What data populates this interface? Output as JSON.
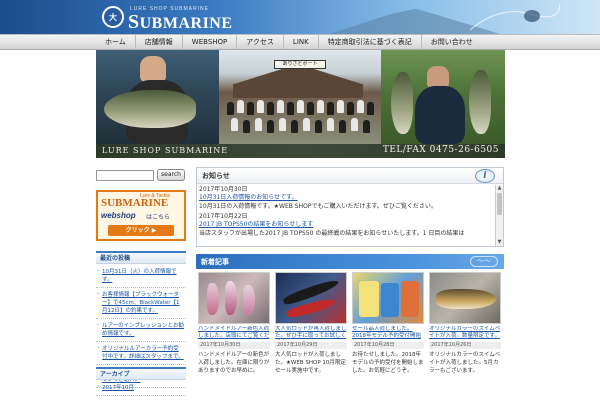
{
  "header": {
    "logo_emblem": "大",
    "logo_subtext": "LURE SHOP SUBMARINE",
    "logo_first_letter": "S",
    "logo_rest": "UBMARINE"
  },
  "nav": {
    "items": [
      {
        "label": "ホーム"
      },
      {
        "label": "店舗情報"
      },
      {
        "label": "WEBSHOP"
      },
      {
        "label": "アクセス"
      },
      {
        "label": "LINK"
      },
      {
        "label": "特定商取引法に基づく表記"
      },
      {
        "label": "お問い合わせ"
      }
    ]
  },
  "banner": {
    "shop_sign": "ありさとボート",
    "shop_name": "LURE SHOP SUBMARINE",
    "tel": "TEL/FAX 0475-26-6505"
  },
  "sidebar": {
    "search_placeholder": "",
    "search_button": "search",
    "webshop": {
      "small": "Lure & Tackle",
      "brand": "SUBMARINE",
      "shop": "webshop",
      "kochira": "はこちら",
      "click": "クリック ▶"
    },
    "recent_head": "最近の投稿",
    "recent_links": [
      {
        "label": "10月31日（火）の入荷情報です。"
      },
      {
        "label": "お客様情報【ブラックウォーター】で45cm、BlackWater【1月12日】の釣果です。"
      },
      {
        "label": "ルアーのインプレッションとお勧め情報です。"
      },
      {
        "label": "オリジナルルアーカラー予約受付中です。詳細はスタッフまで。"
      },
      {
        "label": "シーズン後半のおすすめリグについてご紹介。"
      }
    ],
    "archive_head": "アーカイブ",
    "archive_links": [
      {
        "label": "2017年10月"
      }
    ]
  },
  "news": {
    "title": "お知らせ",
    "info_icon": "i",
    "entries": [
      {
        "date": "2017年10月30日",
        "link": "10月31日入荷情報のお知らせです。",
        "text": "10月31日の入荷情報です。★WEB SHOPでもご購入いただけます。ぜひご覧ください。"
      },
      {
        "date": "2017年10月22日",
        "link": "2017 JB TOPS50の結果をお知らせします",
        "text": "当店スタッフが出場した2017 JB TOPS50 の最終戦の結果をお知らせいたします。1 日目の結果は"
      }
    ]
  },
  "posts": {
    "title": "新着記事",
    "deco": "〜〜",
    "items": [
      {
        "title": "ハンドメイドルアー新色入荷しました。店頭にてご覧ください",
        "date": "2017年10月30日",
        "excerpt": "ハンドメイドルアーの新色が入荷しました。在庫に限りがありますのでお早めに。"
      },
      {
        "title": "大人気ロッドが再入荷しました。ぜひ手に取ってお試しください",
        "date": "2017年10月29日",
        "excerpt": "大人気ロッドが入荷しました。★WEB SHOP 10月限定セール実施中です。"
      },
      {
        "title": "セール品入荷しました。2018年モデル予約受付開始しました。",
        "date": "2017年10月28日",
        "excerpt": "お待たせしました。2018年モデルの予約受付を開始しました。お気軽にどうぞ。"
      },
      {
        "title": "オリジナルカラーのスイムベイトが入荷。数量限定です。",
        "date": "2017年10月26日",
        "excerpt": "オリジナルカラーのスイムベイトが入荷しました。5月カラーもございます。"
      }
    ]
  }
}
